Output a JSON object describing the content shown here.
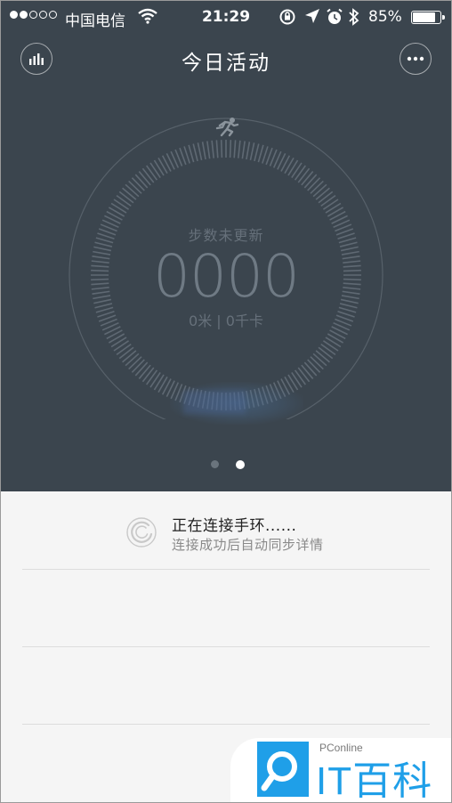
{
  "status_bar": {
    "carrier": "中国电信",
    "time": "21:29",
    "battery": "85%",
    "battery_level": 0.85,
    "signal_bars_filled": 2,
    "signal_bars_total": 5
  },
  "header": {
    "title": "今日活动",
    "left_icon": "bar-chart-icon",
    "right_icon": "more-icon"
  },
  "activity": {
    "steps_label": "步数未更新",
    "steps_value": "0000",
    "distance_calories": "0米 | 0千卡",
    "icon": "running-icon"
  },
  "pager": {
    "pages": 2,
    "active_index": 1
  },
  "connection": {
    "title": "正在连接手环......",
    "subtitle": "连接成功后自动同步详情",
    "icon": "spinner-icon"
  },
  "watermark": {
    "small_text": "PConline",
    "big_text": "IT百科"
  },
  "colors": {
    "header_bg": "#3b454e",
    "content_bg": "#f5f5f5",
    "accent_blue": "#1f9fe8"
  }
}
